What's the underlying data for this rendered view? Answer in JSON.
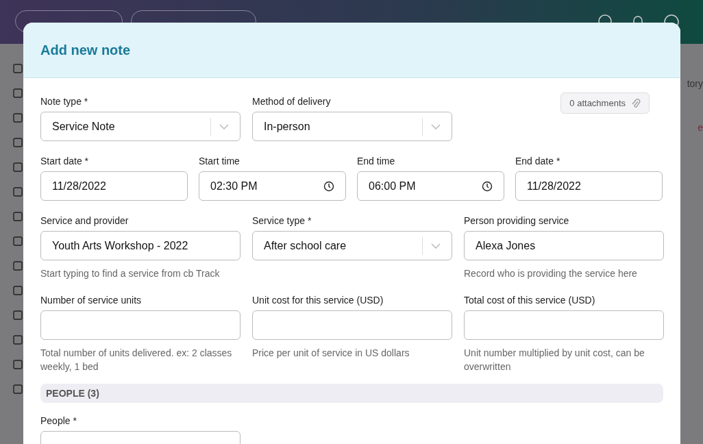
{
  "background_fragments": [
    "tory",
    "e"
  ],
  "modal": {
    "title": "Add new note",
    "attachments": "0 attachments",
    "rows": [
      {
        "fields": [
          {
            "label": "Note type *",
            "kind": "select",
            "value": "Service Note"
          },
          {
            "label": "Method of delivery",
            "kind": "select",
            "value": "In-person"
          }
        ]
      },
      {
        "fields": [
          {
            "label": "Start date *",
            "kind": "input",
            "value": "11/28/2022"
          },
          {
            "label": "Start time",
            "kind": "time",
            "value": "02:30 PM"
          },
          {
            "label": "End time",
            "kind": "time",
            "value": "06:00 PM"
          },
          {
            "label": "End date *",
            "kind": "input",
            "value": "11/28/2022"
          }
        ]
      },
      {
        "fields": [
          {
            "label": "Service and provider",
            "kind": "input",
            "value": "Youth Arts Workshop - 2022",
            "hint": "Start typing to find a service from cb Track"
          },
          {
            "label": "Service type *",
            "kind": "select",
            "value": "After school care"
          },
          {
            "label": "Person providing service",
            "kind": "input",
            "value": "Alexa Jones",
            "hint": "Record who is providing the service here"
          }
        ]
      },
      {
        "fields": [
          {
            "label": "Number of service units",
            "kind": "input",
            "hint": "Total number of units delivered. ex: 2 classes weekly, 1 bed"
          },
          {
            "label": "Unit cost for this service (USD)",
            "kind": "input",
            "hint": "Price per unit of service in US dollars"
          },
          {
            "label": "Total cost of this service (USD)",
            "kind": "input",
            "hint": "Unit number multiplied by unit cost, can be overwritten"
          }
        ]
      }
    ],
    "section": "PEOPLE (3)",
    "people": {
      "label": "People *"
    }
  }
}
